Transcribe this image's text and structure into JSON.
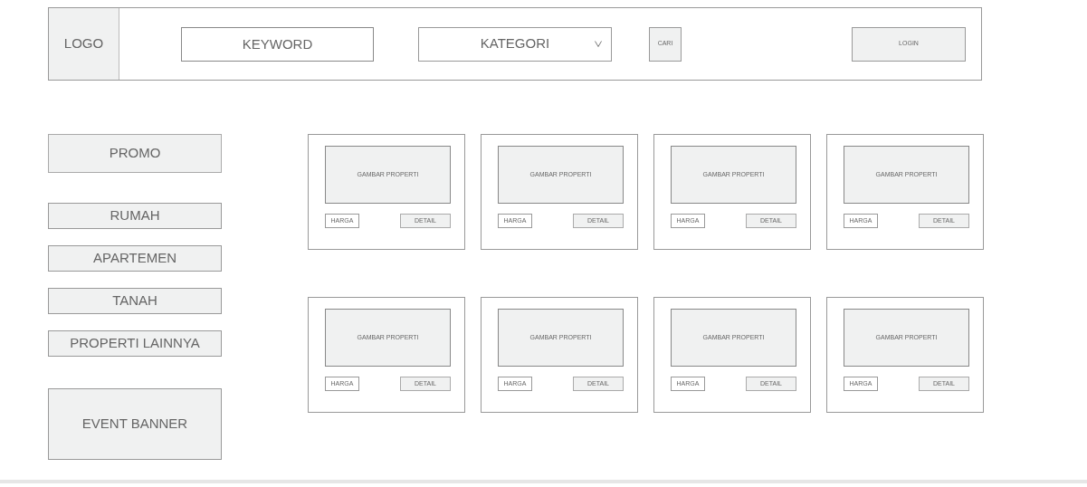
{
  "header": {
    "logo": "LOGO",
    "search": {
      "placeholder": "KEYWORD"
    },
    "category_select": {
      "value": "KATEGORI"
    },
    "search_button": "CARI",
    "login_button": "LOGIN"
  },
  "sidebar": {
    "promo": "PROMO",
    "categories": [
      "RUMAH",
      "APARTEMEN",
      "TANAH",
      "PROPERTI LAINNYA"
    ],
    "event_banner": "EVENT BANNER"
  },
  "listings": [
    {
      "image_label": "GAMBAR PROPERTI",
      "price_button": "HARGA",
      "detail_button": "DETAIL"
    },
    {
      "image_label": "GAMBAR PROPERTI",
      "price_button": "HARGA",
      "detail_button": "DETAIL"
    },
    {
      "image_label": "GAMBAR PROPERTI",
      "price_button": "HARGA",
      "detail_button": "DETAIL"
    },
    {
      "image_label": "GAMBAR PROPERTI",
      "price_button": "HARGA",
      "detail_button": "DETAIL"
    },
    {
      "image_label": "GAMBAR PROPERTI",
      "price_button": "HARGA",
      "detail_button": "DETAIL"
    },
    {
      "image_label": "GAMBAR PROPERTI",
      "price_button": "HARGA",
      "detail_button": "DETAIL"
    },
    {
      "image_label": "GAMBAR PROPERTI",
      "price_button": "HARGA",
      "detail_button": "DETAIL"
    },
    {
      "image_label": "GAMBAR PROPERTI",
      "price_button": "HARGA",
      "detail_button": "DETAIL"
    }
  ]
}
